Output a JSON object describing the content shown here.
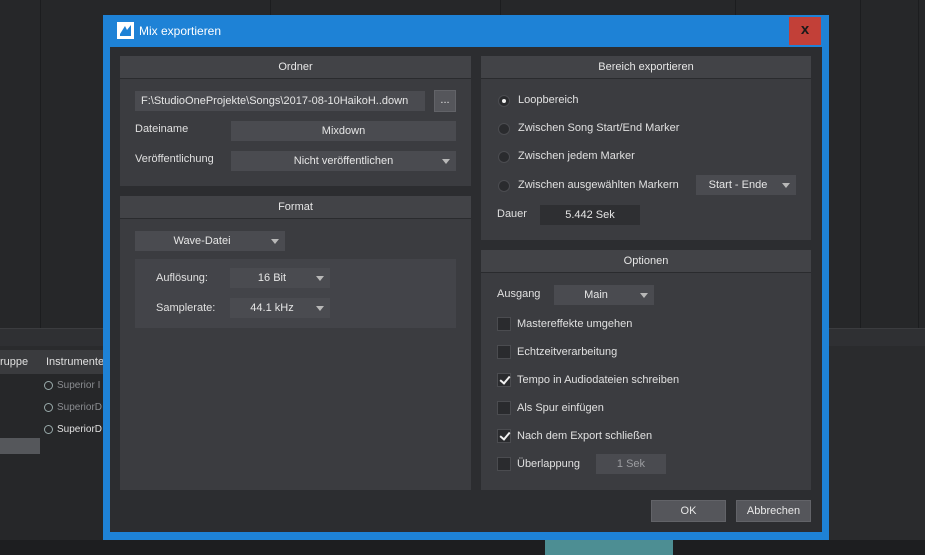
{
  "background": {
    "track_headers": [
      "ruppe",
      "Instrumente"
    ],
    "tracks": [
      "Superior I",
      "SuperiorD",
      "SuperiorD"
    ]
  },
  "dialog": {
    "title": "Mix exportieren",
    "close_label": "x",
    "ordner": {
      "heading": "Ordner",
      "path": "F:\\StudioOneProjekte\\Songs\\2017-08-10HaikoH..down",
      "browse_label": "...",
      "dateiname_label": "Dateiname",
      "dateiname_value": "Mixdown",
      "veroeffentlichung_label": "Veröffentlichung",
      "veroeffentlichung_value": "Nicht veröffentlichen"
    },
    "format": {
      "heading": "Format",
      "type_value": "Wave-Datei",
      "aufloesung_label": "Auflösung:",
      "aufloesung_value": "16 Bit",
      "samplerate_label": "Samplerate:",
      "samplerate_value": "44.1 kHz"
    },
    "bereich": {
      "heading": "Bereich exportieren",
      "options": [
        "Loopbereich",
        "Zwischen Song Start/End Marker",
        "Zwischen jedem Marker",
        "Zwischen ausgewählten Markern"
      ],
      "selected_index": 0,
      "marker_select_value": "Start - Ende",
      "dauer_label": "Dauer",
      "dauer_value": "5.442 Sek"
    },
    "optionen": {
      "heading": "Optionen",
      "ausgang_label": "Ausgang",
      "ausgang_value": "Main",
      "checkboxes": [
        {
          "label": "Mastereffekte umgehen",
          "checked": false
        },
        {
          "label": "Echtzeitverarbeitung",
          "checked": false
        },
        {
          "label": "Tempo in Audiodateien schreiben",
          "checked": true
        },
        {
          "label": "Als Spur einfügen",
          "checked": false
        },
        {
          "label": "Nach dem Export schließen",
          "checked": true
        },
        {
          "label": "Überlappung",
          "checked": false
        }
      ],
      "ueberlappung_value": "1 Sek"
    },
    "ok_label": "OK",
    "cancel_label": "Abbrechen"
  }
}
